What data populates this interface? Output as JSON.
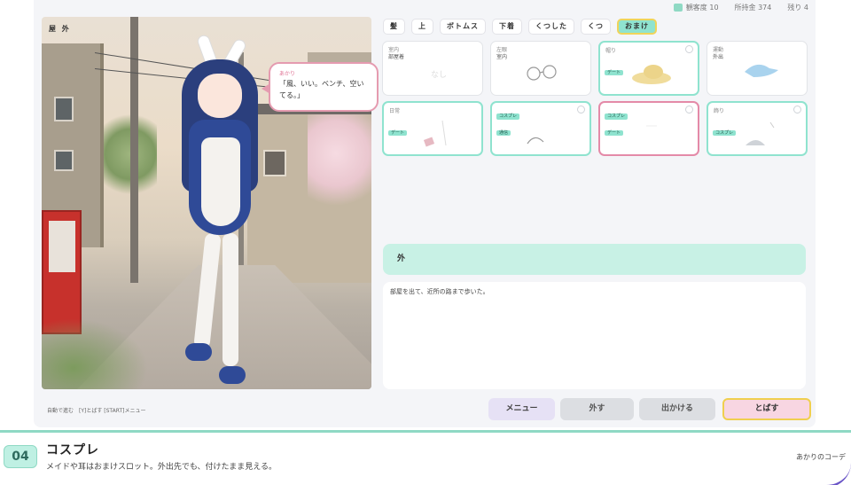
{
  "status": {
    "counter1": "観客度 10",
    "money": "所持金 374",
    "remaining": "残り 4"
  },
  "scene": {
    "location": "屋 外",
    "speaker": "あかり",
    "speech": "「風、いい。ベンチ、空いてる。」"
  },
  "tabs": [
    {
      "label": "髪",
      "active": false
    },
    {
      "label": "上",
      "active": false
    },
    {
      "label": "ボトムス",
      "active": false
    },
    {
      "label": "下着",
      "active": false
    },
    {
      "label": "くつした",
      "active": false
    },
    {
      "label": "くつ",
      "active": false
    },
    {
      "label": "おまけ",
      "active": true
    }
  ],
  "items": [
    {
      "slot": "室内",
      "name": "部屋着",
      "tags": [],
      "style": "plain",
      "icon": "blank"
    },
    {
      "slot": "左眼",
      "name": "室内",
      "tags": [],
      "style": "plain",
      "icon": "glasses-icon"
    },
    {
      "slot": "帽り",
      "name": "",
      "tags": [
        "デート"
      ],
      "style": "teal",
      "icon": "straw-hat-icon"
    },
    {
      "slot": "運動",
      "name": "外出",
      "tags": [],
      "style": "plain",
      "icon": "cap-icon"
    },
    {
      "slot": "日常",
      "name": "",
      "tags": [
        "デート"
      ],
      "style": "teal",
      "icon": "pin-icon"
    },
    {
      "slot": "",
      "name": "",
      "tags": [
        "コスプレ",
        "通信"
      ],
      "style": "teal",
      "icon": "headband-icon"
    },
    {
      "slot": "",
      "name": "",
      "tags": [
        "コスプレ",
        "デート"
      ],
      "style": "pink",
      "icon": "blank"
    },
    {
      "slot": "飾り",
      "name": "",
      "tags": [
        "コスプレ"
      ],
      "style": "teal",
      "icon": "bunny-ears-icon"
    }
  ],
  "description": {
    "title": "外",
    "body": "部屋を出て、近所の路まで歩いた。"
  },
  "footer": {
    "hint": "自動で進む　[Y]とばす [START]メニュー",
    "buttons": {
      "menu": "メニュー",
      "remove": "外す",
      "go_out": "出かける",
      "skip": "とばす"
    }
  },
  "caption": {
    "number": "04",
    "title": "コスプレ",
    "subtitle": "メイドや耳はおまけスロット。外出先でも、付けたまま見える。",
    "right": "あかりのコーデ"
  },
  "colors": {
    "accent_teal": "#8fe3cf",
    "accent_pink": "#e48aa8",
    "highlight_yellow": "#f0d45a"
  }
}
